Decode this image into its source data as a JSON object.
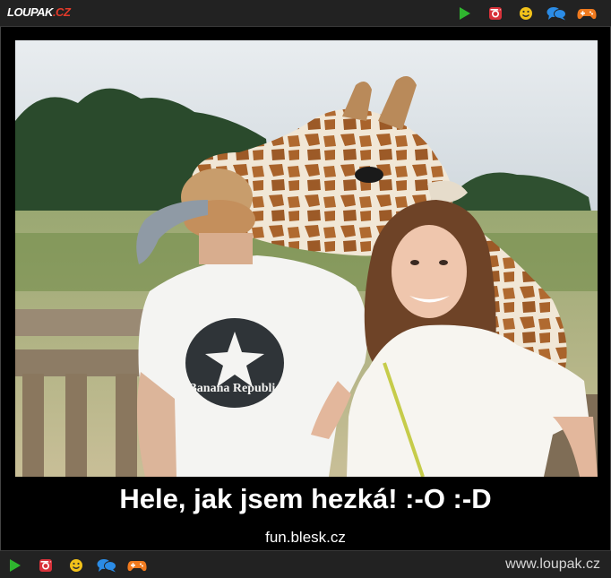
{
  "header": {
    "logo_main": "LOUPAK",
    "logo_tld": ".CZ",
    "icons": [
      "play-icon",
      "instagram-icon",
      "smiley-icon",
      "chat-icon",
      "gamepad-icon"
    ]
  },
  "post": {
    "caption": "Hele, jak jsem hezká! :-O :-D",
    "source": "fun.blesk.cz",
    "shirt_text": "Banana Republic"
  },
  "footer": {
    "icons": [
      "play-icon",
      "instagram-icon",
      "smiley-icon",
      "chat-icon",
      "gamepad-icon"
    ],
    "site": "www.loupak.cz"
  },
  "colors": {
    "play": "#2fb52f",
    "instagram": "#d8323a",
    "smiley": "#f2c21a",
    "chat": "#2b8ce6",
    "gamepad": "#f07a1e"
  }
}
